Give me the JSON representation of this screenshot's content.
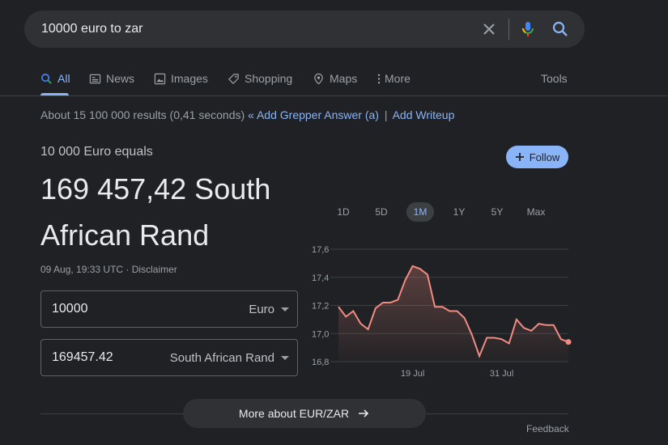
{
  "search": {
    "query": "10000 euro to zar"
  },
  "tabs": [
    {
      "label": "All"
    },
    {
      "label": "News"
    },
    {
      "label": "Images"
    },
    {
      "label": "Shopping"
    },
    {
      "label": "Maps"
    },
    {
      "label": "More"
    }
  ],
  "tools_label": "Tools",
  "stats": {
    "text": "About 15 100 000 results (0,41 seconds)",
    "grepper": "« Add Grepper Answer (a)",
    "separator": "|",
    "writeup": "Add Writeup"
  },
  "converter": {
    "equals_text": "10 000 Euro equals",
    "result_text": "169 457,42 South African Rand",
    "timestamp": "09 Aug, 19:33 UTC",
    "dot": "·",
    "disclaimer": "Disclaimer",
    "from_value": "10000",
    "from_currency": "Euro",
    "to_value": "169457.42",
    "to_currency": "South African Rand"
  },
  "follow_label": "Follow",
  "ranges": [
    {
      "label": "1D",
      "active": false
    },
    {
      "label": "5D",
      "active": false
    },
    {
      "label": "1M",
      "active": true
    },
    {
      "label": "1Y",
      "active": false
    },
    {
      "label": "5Y",
      "active": false
    },
    {
      "label": "Max",
      "active": false
    }
  ],
  "more_about_label": "More about EUR/ZAR",
  "feedback_label": "Feedback",
  "colors": {
    "line": "#f28b82",
    "accent": "#8ab4f8",
    "background": "#202124"
  },
  "chart_data": {
    "type": "line",
    "ylim": [
      16.8,
      17.6
    ],
    "yticks": [
      "17,6",
      "17,4",
      "17,2",
      "17,0",
      "16,8"
    ],
    "xtick_labels": [
      "19 Jul",
      "31 Jul"
    ],
    "xtick_index": [
      10,
      22
    ],
    "values": [
      17.19,
      17.12,
      17.16,
      17.07,
      17.03,
      17.18,
      17.22,
      17.22,
      17.24,
      17.38,
      17.48,
      17.46,
      17.42,
      17.19,
      17.19,
      17.16,
      17.16,
      17.11,
      16.99,
      16.84,
      16.97,
      16.97,
      16.96,
      16.93,
      17.1,
      17.04,
      17.02,
      17.07,
      17.06,
      17.06,
      16.96,
      16.94
    ]
  }
}
